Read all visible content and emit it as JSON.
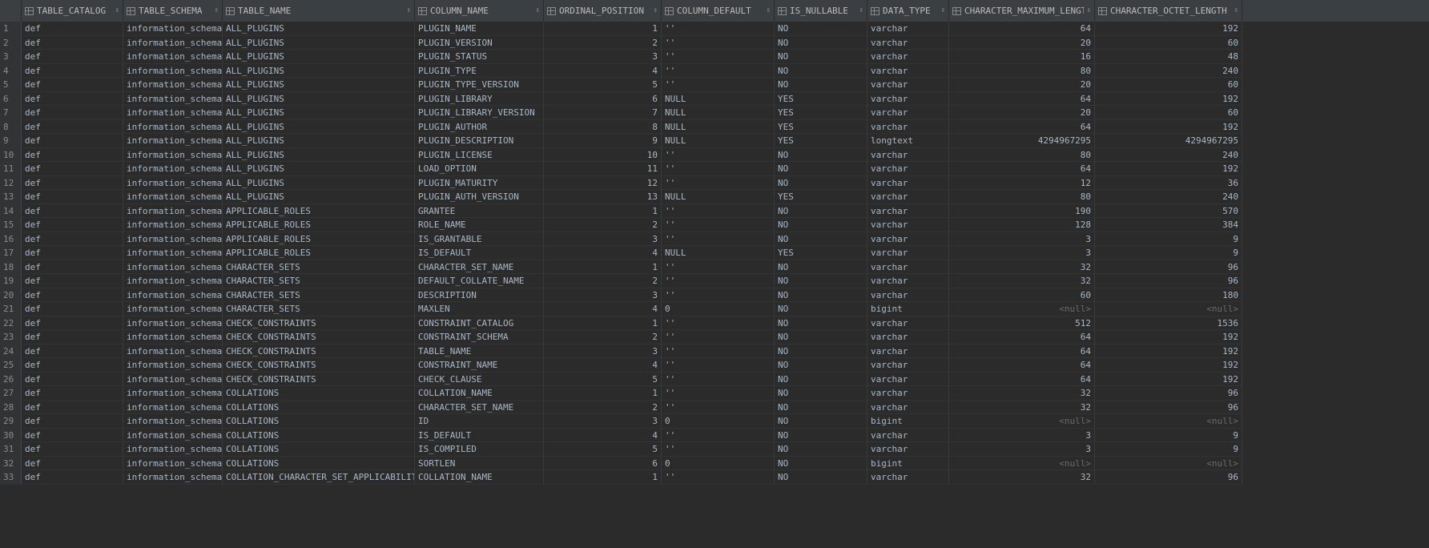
{
  "columns": [
    {
      "label": "TABLE_CATALOG",
      "cls": "w0",
      "num": false
    },
    {
      "label": "TABLE_SCHEMA",
      "cls": "w1",
      "num": false
    },
    {
      "label": "TABLE_NAME",
      "cls": "w2",
      "num": false
    },
    {
      "label": "COLUMN_NAME",
      "cls": "w3",
      "num": false
    },
    {
      "label": "ORDINAL_POSITION",
      "cls": "w4",
      "num": true
    },
    {
      "label": "COLUMN_DEFAULT",
      "cls": "w5",
      "num": false
    },
    {
      "label": "IS_NULLABLE",
      "cls": "w6",
      "num": false
    },
    {
      "label": "DATA_TYPE",
      "cls": "w7",
      "num": false
    },
    {
      "label": "CHARACTER_MAXIMUM_LENGTH",
      "cls": "w8",
      "num": true
    },
    {
      "label": "CHARACTER_OCTET_LENGTH",
      "cls": "w9",
      "num": true
    }
  ],
  "rows": [
    [
      "def",
      "information_schema",
      "ALL_PLUGINS",
      "PLUGIN_NAME",
      "1",
      "''",
      "NO",
      "varchar",
      "64",
      "192"
    ],
    [
      "def",
      "information_schema",
      "ALL_PLUGINS",
      "PLUGIN_VERSION",
      "2",
      "''",
      "NO",
      "varchar",
      "20",
      "60"
    ],
    [
      "def",
      "information_schema",
      "ALL_PLUGINS",
      "PLUGIN_STATUS",
      "3",
      "''",
      "NO",
      "varchar",
      "16",
      "48"
    ],
    [
      "def",
      "information_schema",
      "ALL_PLUGINS",
      "PLUGIN_TYPE",
      "4",
      "''",
      "NO",
      "varchar",
      "80",
      "240"
    ],
    [
      "def",
      "information_schema",
      "ALL_PLUGINS",
      "PLUGIN_TYPE_VERSION",
      "5",
      "''",
      "NO",
      "varchar",
      "20",
      "60"
    ],
    [
      "def",
      "information_schema",
      "ALL_PLUGINS",
      "PLUGIN_LIBRARY",
      "6",
      "NULL",
      "YES",
      "varchar",
      "64",
      "192"
    ],
    [
      "def",
      "information_schema",
      "ALL_PLUGINS",
      "PLUGIN_LIBRARY_VERSION",
      "7",
      "NULL",
      "YES",
      "varchar",
      "20",
      "60"
    ],
    [
      "def",
      "information_schema",
      "ALL_PLUGINS",
      "PLUGIN_AUTHOR",
      "8",
      "NULL",
      "YES",
      "varchar",
      "64",
      "192"
    ],
    [
      "def",
      "information_schema",
      "ALL_PLUGINS",
      "PLUGIN_DESCRIPTION",
      "9",
      "NULL",
      "YES",
      "longtext",
      "4294967295",
      "4294967295"
    ],
    [
      "def",
      "information_schema",
      "ALL_PLUGINS",
      "PLUGIN_LICENSE",
      "10",
      "''",
      "NO",
      "varchar",
      "80",
      "240"
    ],
    [
      "def",
      "information_schema",
      "ALL_PLUGINS",
      "LOAD_OPTION",
      "11",
      "''",
      "NO",
      "varchar",
      "64",
      "192"
    ],
    [
      "def",
      "information_schema",
      "ALL_PLUGINS",
      "PLUGIN_MATURITY",
      "12",
      "''",
      "NO",
      "varchar",
      "12",
      "36"
    ],
    [
      "def",
      "information_schema",
      "ALL_PLUGINS",
      "PLUGIN_AUTH_VERSION",
      "13",
      "NULL",
      "YES",
      "varchar",
      "80",
      "240"
    ],
    [
      "def",
      "information_schema",
      "APPLICABLE_ROLES",
      "GRANTEE",
      "1",
      "''",
      "NO",
      "varchar",
      "190",
      "570"
    ],
    [
      "def",
      "information_schema",
      "APPLICABLE_ROLES",
      "ROLE_NAME",
      "2",
      "''",
      "NO",
      "varchar",
      "128",
      "384"
    ],
    [
      "def",
      "information_schema",
      "APPLICABLE_ROLES",
      "IS_GRANTABLE",
      "3",
      "''",
      "NO",
      "varchar",
      "3",
      "9"
    ],
    [
      "def",
      "information_schema",
      "APPLICABLE_ROLES",
      "IS_DEFAULT",
      "4",
      "NULL",
      "YES",
      "varchar",
      "3",
      "9"
    ],
    [
      "def",
      "information_schema",
      "CHARACTER_SETS",
      "CHARACTER_SET_NAME",
      "1",
      "''",
      "NO",
      "varchar",
      "32",
      "96"
    ],
    [
      "def",
      "information_schema",
      "CHARACTER_SETS",
      "DEFAULT_COLLATE_NAME",
      "2",
      "''",
      "NO",
      "varchar",
      "32",
      "96"
    ],
    [
      "def",
      "information_schema",
      "CHARACTER_SETS",
      "DESCRIPTION",
      "3",
      "''",
      "NO",
      "varchar",
      "60",
      "180"
    ],
    [
      "def",
      "information_schema",
      "CHARACTER_SETS",
      "MAXLEN",
      "4",
      "0",
      "NO",
      "bigint",
      "<null>",
      "<null>"
    ],
    [
      "def",
      "information_schema",
      "CHECK_CONSTRAINTS",
      "CONSTRAINT_CATALOG",
      "1",
      "''",
      "NO",
      "varchar",
      "512",
      "1536"
    ],
    [
      "def",
      "information_schema",
      "CHECK_CONSTRAINTS",
      "CONSTRAINT_SCHEMA",
      "2",
      "''",
      "NO",
      "varchar",
      "64",
      "192"
    ],
    [
      "def",
      "information_schema",
      "CHECK_CONSTRAINTS",
      "TABLE_NAME",
      "3",
      "''",
      "NO",
      "varchar",
      "64",
      "192"
    ],
    [
      "def",
      "information_schema",
      "CHECK_CONSTRAINTS",
      "CONSTRAINT_NAME",
      "4",
      "''",
      "NO",
      "varchar",
      "64",
      "192"
    ],
    [
      "def",
      "information_schema",
      "CHECK_CONSTRAINTS",
      "CHECK_CLAUSE",
      "5",
      "''",
      "NO",
      "varchar",
      "64",
      "192"
    ],
    [
      "def",
      "information_schema",
      "COLLATIONS",
      "COLLATION_NAME",
      "1",
      "''",
      "NO",
      "varchar",
      "32",
      "96"
    ],
    [
      "def",
      "information_schema",
      "COLLATIONS",
      "CHARACTER_SET_NAME",
      "2",
      "''",
      "NO",
      "varchar",
      "32",
      "96"
    ],
    [
      "def",
      "information_schema",
      "COLLATIONS",
      "ID",
      "3",
      "0",
      "NO",
      "bigint",
      "<null>",
      "<null>"
    ],
    [
      "def",
      "information_schema",
      "COLLATIONS",
      "IS_DEFAULT",
      "4",
      "''",
      "NO",
      "varchar",
      "3",
      "9"
    ],
    [
      "def",
      "information_schema",
      "COLLATIONS",
      "IS_COMPILED",
      "5",
      "''",
      "NO",
      "varchar",
      "3",
      "9"
    ],
    [
      "def",
      "information_schema",
      "COLLATIONS",
      "SORTLEN",
      "6",
      "0",
      "NO",
      "bigint",
      "<null>",
      "<null>"
    ],
    [
      "def",
      "information_schema",
      "COLLATION_CHARACTER_SET_APPLICABILITY",
      "COLLATION_NAME",
      "1",
      "''",
      "NO",
      "varchar",
      "32",
      "96"
    ]
  ],
  "row_numbers": [
    "1",
    "2",
    "3",
    "4",
    "5",
    "6",
    "7",
    "8",
    "9",
    "10",
    "11",
    "12",
    "13",
    "14",
    "15",
    "16",
    "17",
    "18",
    "19",
    "20",
    "21",
    "22",
    "23",
    "24",
    "25",
    "26",
    "27",
    "28",
    "29",
    "30",
    "31",
    "32",
    "33"
  ],
  "icons": {
    "column": "column-icon",
    "sort": "sort-icon"
  },
  "colors": {
    "background": "#2b2b2b",
    "header": "#3c3f41",
    "text": "#a9b7c6",
    "null_text": "#6b6b6b"
  }
}
